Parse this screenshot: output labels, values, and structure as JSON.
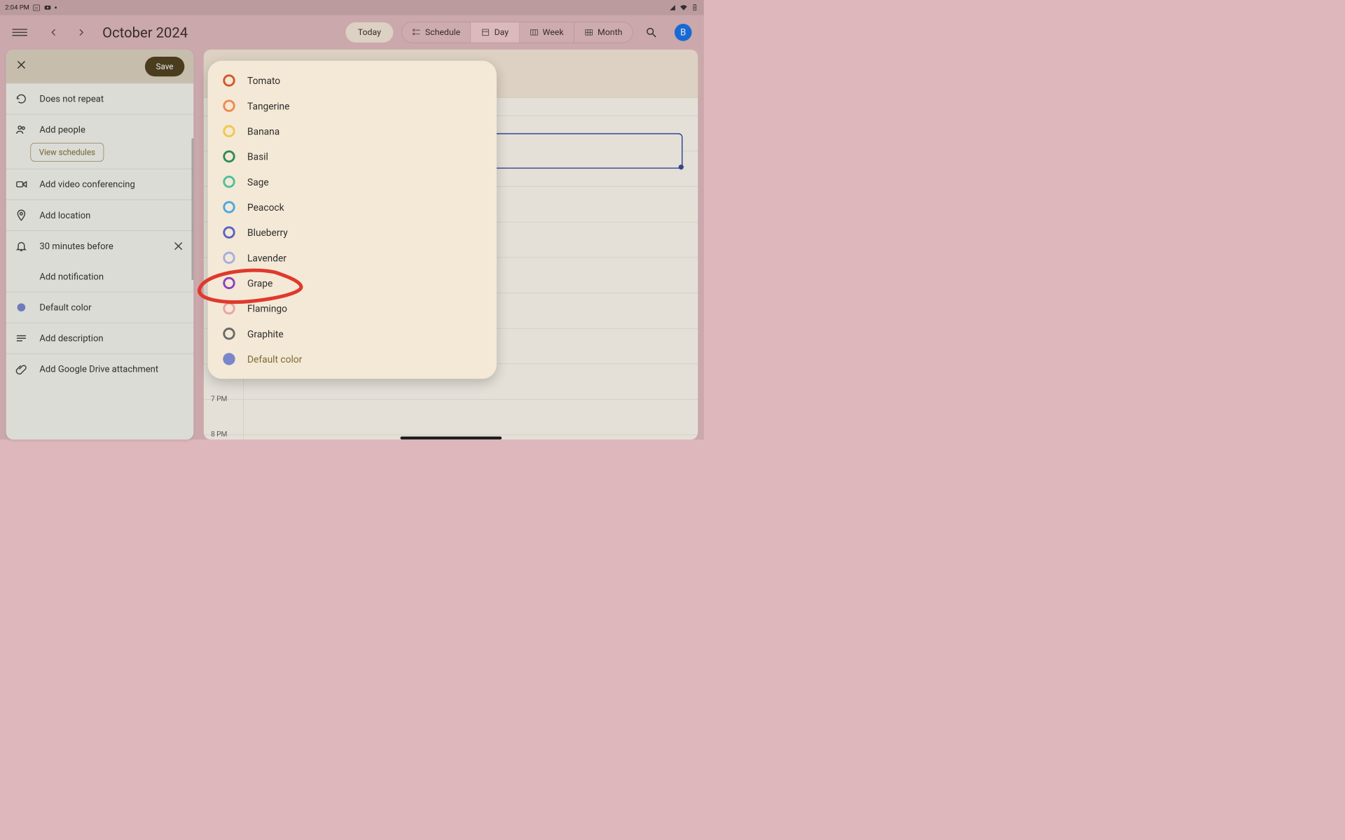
{
  "statusbar": {
    "time": "2:04 PM",
    "date_icon_number": "31"
  },
  "header": {
    "title": "October 2024",
    "today": "Today",
    "views": {
      "schedule": "Schedule",
      "day": "Day",
      "week": "Week",
      "month": "Month"
    },
    "avatar_initial": "B"
  },
  "panel": {
    "save": "Save",
    "rows": {
      "repeat": "Does not repeat",
      "people": "Add people",
      "view_schedules": "View schedules",
      "video": "Add video conferencing",
      "location": "Add location",
      "reminder": "30 minutes before",
      "add_notif": "Add notification",
      "color": "Default color",
      "description": "Add description",
      "attach": "Add Google Drive attachment"
    }
  },
  "color_picker": {
    "options": [
      {
        "name": "Tomato",
        "color": "#d5552a",
        "type": "ring"
      },
      {
        "name": "Tangerine",
        "color": "#ef8a4f",
        "type": "ring"
      },
      {
        "name": "Banana",
        "color": "#efc850",
        "type": "ring"
      },
      {
        "name": "Basil",
        "color": "#2f8b57",
        "type": "ring"
      },
      {
        "name": "Sage",
        "color": "#4fbf9c",
        "type": "ring"
      },
      {
        "name": "Peacock",
        "color": "#4aa7e0",
        "type": "ring"
      },
      {
        "name": "Blueberry",
        "color": "#5a62c2",
        "type": "ring"
      },
      {
        "name": "Lavender",
        "color": "#a6aee0",
        "type": "ring"
      },
      {
        "name": "Grape",
        "color": "#8c3fc0",
        "type": "ring"
      },
      {
        "name": "Flamingo",
        "color": "#e9a4a0",
        "type": "ring"
      },
      {
        "name": "Graphite",
        "color": "#6a6a6a",
        "type": "ring"
      },
      {
        "name": "Default color",
        "color": "#7986cb",
        "type": "filled",
        "selected": true
      }
    ]
  },
  "calendar_canvas": {
    "visible_hours": [
      "7 PM",
      "8 PM"
    ]
  },
  "annotation": {
    "highlighted_option": "Grape"
  }
}
